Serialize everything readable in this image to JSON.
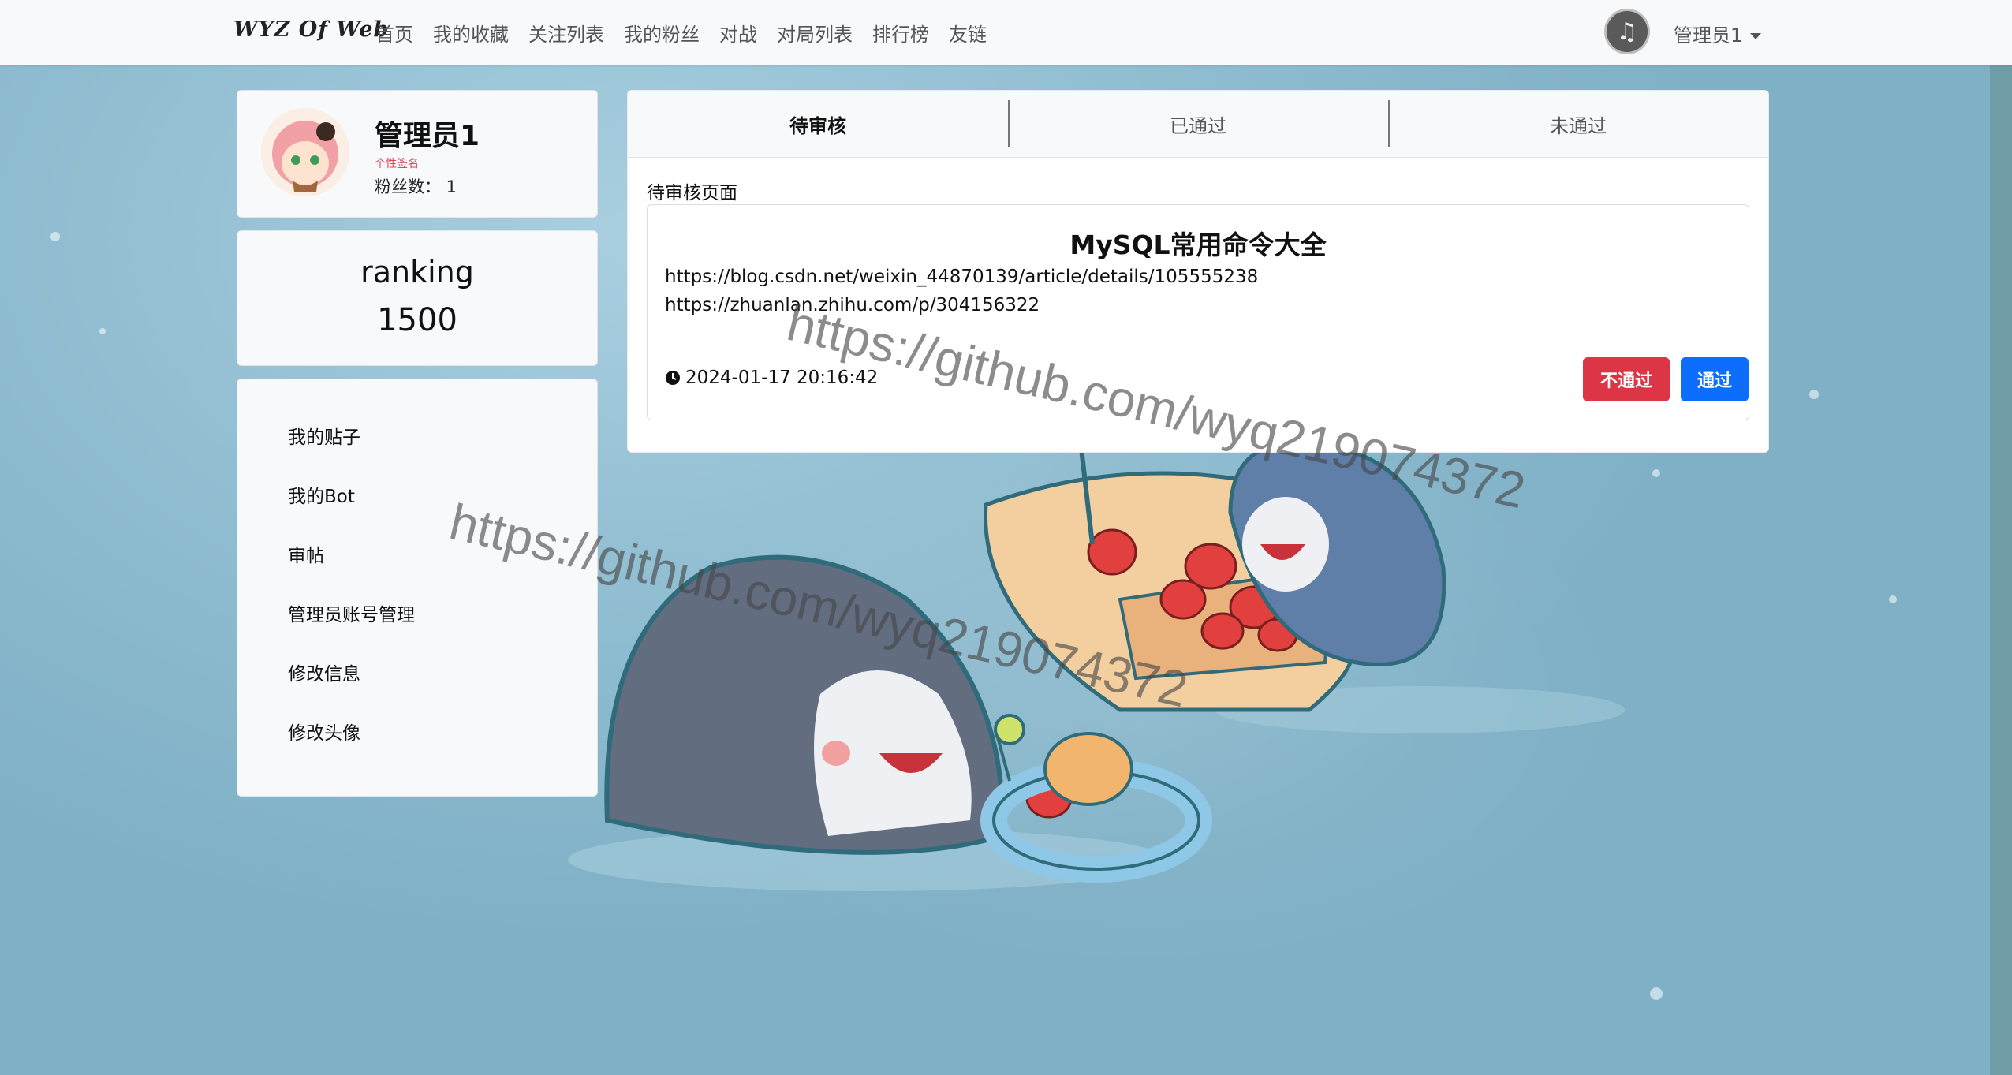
{
  "navbar": {
    "brand": "WYZ Of Web",
    "links": [
      "首页",
      "我的收藏",
      "关注列表",
      "我的粉丝",
      "对战",
      "对局列表",
      "排行榜",
      "友链"
    ],
    "user": "管理员1"
  },
  "profile": {
    "name": "管理员1",
    "signature": "个性签名",
    "fans": "粉丝数： 1"
  },
  "ranking": {
    "label": "ranking",
    "value": "1500"
  },
  "menu": [
    "我的贴子",
    "我的Bot",
    "审帖",
    "管理员账号管理",
    "修改信息",
    "修改头像"
  ],
  "tabs": [
    "待审核",
    "已通过",
    "未通过"
  ],
  "active_tab": "待审核",
  "section_title": "待审核页面",
  "post": {
    "title": "MySQL常用命令大全",
    "lines": [
      "https://blog.csdn.net/weixin_44870139/article/details/105555238",
      "https://zhuanlan.zhihu.com/p/304156322"
    ],
    "time": "2024-01-17 20:16:42",
    "reject_label": "不通过",
    "approve_label": "通过"
  },
  "watermark": "https://github.com/wyq219074372",
  "colors": {
    "reject": "#dc3545",
    "approve": "#0d6efd",
    "signature": "#e0445a"
  }
}
